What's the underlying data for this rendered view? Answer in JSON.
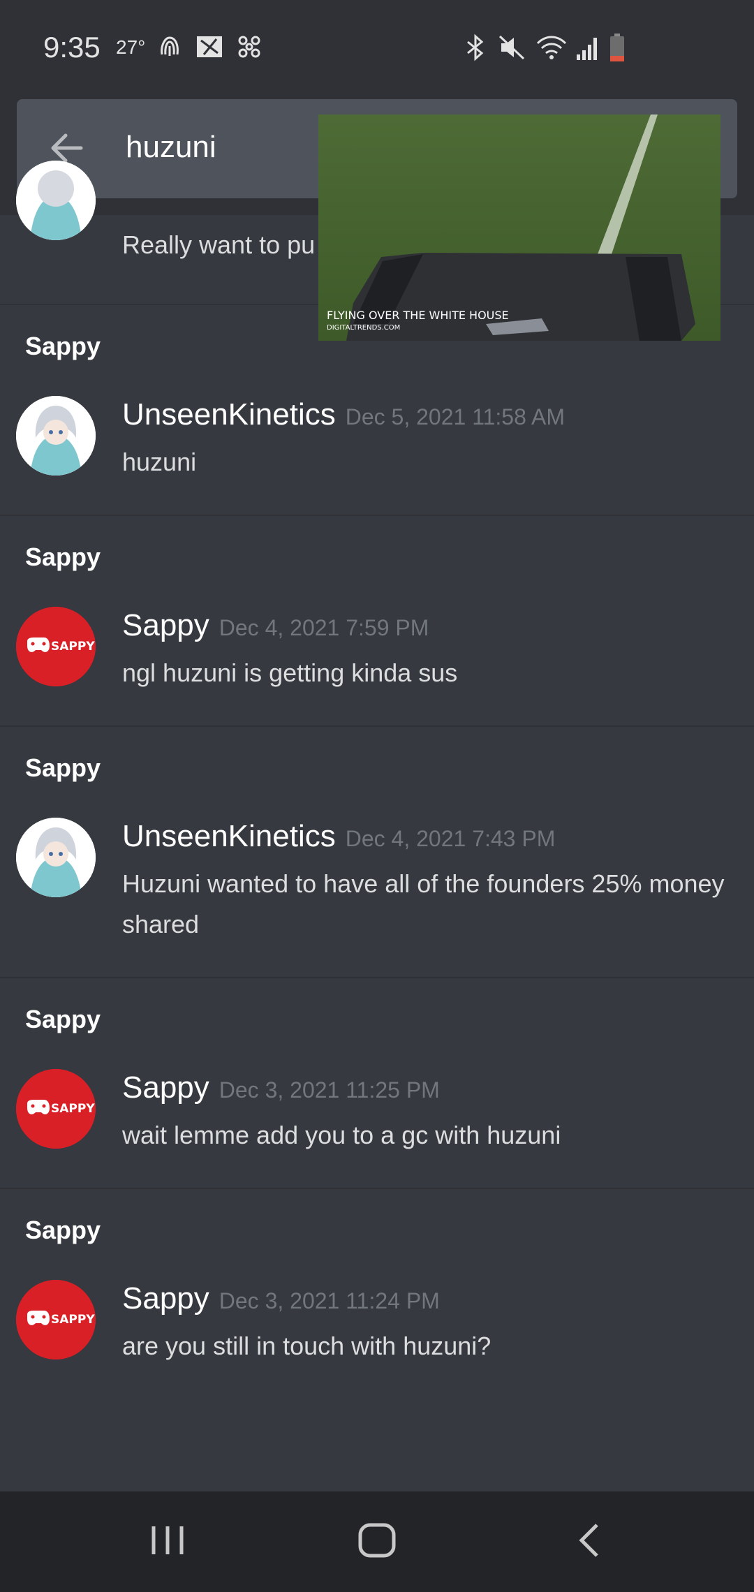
{
  "status_bar": {
    "time": "9:35",
    "temperature": "27°",
    "icons_left": [
      "fingerprint-icon",
      "gallery-icon",
      "fan-icon"
    ],
    "icons_right": [
      "bluetooth-icon",
      "mute-icon",
      "wifi-icon",
      "signal-icon",
      "battery-icon"
    ]
  },
  "search": {
    "query": "huzuni",
    "back_icon": "back-arrow-icon"
  },
  "video_overlay": {
    "caption": "FLYING OVER THE WHITE HOUSE",
    "source": "DIGITALTRENDS.COM"
  },
  "first_result": {
    "preview": "Really want to pu"
  },
  "results": [
    {
      "channel": "Sappy",
      "author": "UnseenKinetics",
      "timestamp": "Dec 5, 2021 11:58 AM",
      "content": "huzuni",
      "avatar": "anime"
    },
    {
      "channel": "Sappy",
      "author": "Sappy",
      "timestamp": "Dec 4, 2021 7:59 PM",
      "content": "ngl huzuni is getting kinda sus",
      "avatar": "sappy"
    },
    {
      "channel": "Sappy",
      "author": "UnseenKinetics",
      "timestamp": "Dec 4, 2021 7:43 PM",
      "content": "Huzuni wanted to have all of the founders 25% money shared",
      "avatar": "anime"
    },
    {
      "channel": "Sappy",
      "author": "Sappy",
      "timestamp": "Dec 3, 2021 11:25 PM",
      "content": "wait lemme add you to a gc with huzuni",
      "avatar": "sappy"
    },
    {
      "channel": "Sappy",
      "author": "Sappy",
      "timestamp": "Dec 3, 2021 11:24 PM",
      "content": "are you still in touch with huzuni?",
      "avatar": "sappy"
    }
  ],
  "avatar_label": "SAPPY",
  "nav": [
    "recents-icon",
    "home-icon",
    "back-icon"
  ],
  "colors": {
    "background": "#36393f",
    "header": "#2f3136",
    "timestamp": "#72767d",
    "sappy_red": "#d92027"
  }
}
